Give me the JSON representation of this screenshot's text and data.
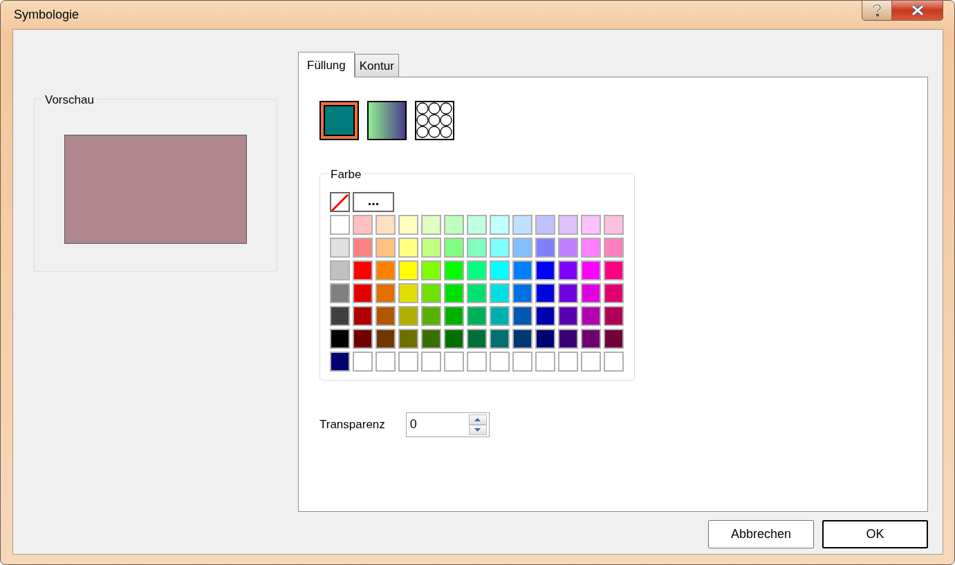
{
  "window": {
    "title": "Symbologie"
  },
  "preview": {
    "label": "Vorschau",
    "color": "#b0878f"
  },
  "tabs": [
    {
      "label": "Füllung",
      "selected": true
    },
    {
      "label": "Kontur",
      "selected": false
    }
  ],
  "fill_types": [
    {
      "kind": "solid",
      "selected": true
    },
    {
      "kind": "gradient",
      "selected": false
    },
    {
      "kind": "pattern",
      "selected": false
    }
  ],
  "color_group": {
    "label": "Farbe",
    "more_button": "...",
    "swatches": [
      [
        {
          "color": "#ffffff"
        },
        {
          "color": "#ffc0c0"
        },
        {
          "color": "#ffe0c0"
        },
        {
          "color": "#ffffc0"
        },
        {
          "color": "#e0ffc0"
        },
        {
          "color": "#c0ffc0"
        },
        {
          "color": "#c0ffe0"
        },
        {
          "color": "#c0ffff"
        },
        {
          "color": "#c0e0ff"
        },
        {
          "color": "#c0c0ff"
        },
        {
          "color": "#e0c0ff"
        },
        {
          "color": "#ffc0ff"
        },
        {
          "color": "#ffc0e0"
        }
      ],
      [
        {
          "color": "#e0e0e0"
        },
        {
          "color": "#ff8080"
        },
        {
          "color": "#ffc080"
        },
        {
          "color": "#ffff80"
        },
        {
          "color": "#c0ff80"
        },
        {
          "color": "#80ff80"
        },
        {
          "color": "#80ffc0"
        },
        {
          "color": "#80ffff"
        },
        {
          "color": "#80c0ff"
        },
        {
          "color": "#8080ff"
        },
        {
          "color": "#c080ff"
        },
        {
          "color": "#ff80ff"
        },
        {
          "color": "#ff80c0"
        }
      ],
      [
        {
          "color": "#c0c0c0"
        },
        {
          "color": "#ff0000"
        },
        {
          "color": "#ff8000"
        },
        {
          "color": "#ffff00"
        },
        {
          "color": "#80ff00"
        },
        {
          "color": "#00ff00"
        },
        {
          "color": "#00ff80"
        },
        {
          "color": "#00ffff"
        },
        {
          "color": "#0080ff"
        },
        {
          "color": "#0000ff"
        },
        {
          "color": "#8000ff"
        },
        {
          "color": "#ff00ff"
        },
        {
          "color": "#ff0080"
        }
      ],
      [
        {
          "color": "#808080"
        },
        {
          "color": "#e00000"
        },
        {
          "color": "#e07000"
        },
        {
          "color": "#e0e000"
        },
        {
          "color": "#70e000"
        },
        {
          "color": "#00e000"
        },
        {
          "color": "#00e070"
        },
        {
          "color": "#00e0e0"
        },
        {
          "color": "#0070e0"
        },
        {
          "color": "#0000e0"
        },
        {
          "color": "#7000e0"
        },
        {
          "color": "#e000e0"
        },
        {
          "color": "#e00070"
        }
      ],
      [
        {
          "color": "#404040"
        },
        {
          "color": "#b00000"
        },
        {
          "color": "#b05800"
        },
        {
          "color": "#b0b000"
        },
        {
          "color": "#58b000"
        },
        {
          "color": "#00b000"
        },
        {
          "color": "#00b058"
        },
        {
          "color": "#00b0b0"
        },
        {
          "color": "#0058b0"
        },
        {
          "color": "#0000b0"
        },
        {
          "color": "#5800b0"
        },
        {
          "color": "#b000b0"
        },
        {
          "color": "#b00058"
        }
      ],
      [
        {
          "color": "#000000"
        },
        {
          "color": "#700000"
        },
        {
          "color": "#703800"
        },
        {
          "color": "#707000"
        },
        {
          "color": "#387000"
        },
        {
          "color": "#007000"
        },
        {
          "color": "#007038"
        },
        {
          "color": "#007070"
        },
        {
          "color": "#003870"
        },
        {
          "color": "#000070"
        },
        {
          "color": "#380070"
        },
        {
          "color": "#700070"
        },
        {
          "color": "#700038"
        }
      ],
      [
        {
          "kind": "color",
          "color": "#000070"
        },
        {
          "kind": "empty"
        },
        {
          "kind": "empty"
        },
        {
          "kind": "empty"
        },
        {
          "kind": "empty"
        },
        {
          "kind": "empty"
        },
        {
          "kind": "empty"
        },
        {
          "kind": "empty"
        },
        {
          "kind": "empty"
        },
        {
          "kind": "empty"
        },
        {
          "kind": "empty"
        },
        {
          "kind": "empty"
        },
        {
          "kind": "empty"
        }
      ]
    ]
  },
  "transparency": {
    "label": "Transparenz",
    "value": "0"
  },
  "buttons": [
    {
      "label": "Abbrechen",
      "default": false
    },
    {
      "label": "OK",
      "default": true
    }
  ]
}
